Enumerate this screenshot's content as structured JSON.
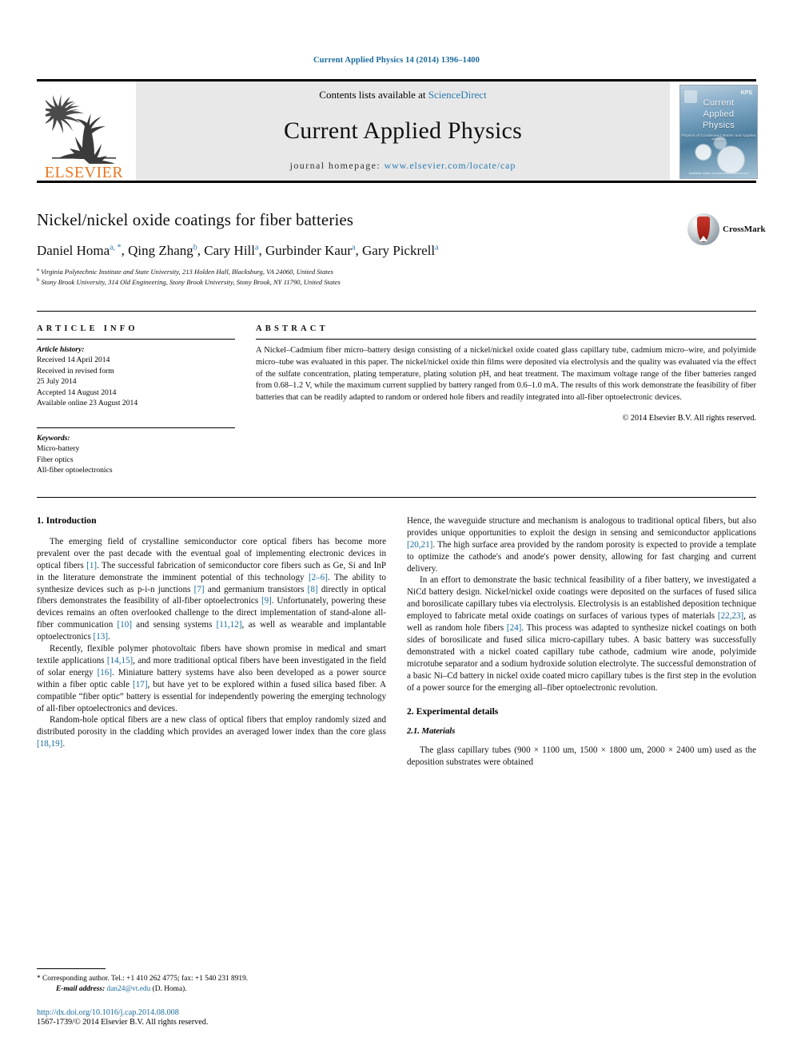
{
  "running_head": "Current Applied Physics 14 (2014) 1396–1400",
  "masthead": {
    "publisher_name": "ELSEVIER",
    "contents_prefix": "Contents lists available at ",
    "contents_link": "ScienceDirect",
    "journal_title": "Current Applied Physics",
    "homepage_prefix": "journal homepage: ",
    "homepage_url": "www.elsevier.com/locate/cap",
    "cover": {
      "line1": "Current",
      "line2": "Applied",
      "line3": "Physics",
      "subtitle": "Physics of Condensed Matter and Applied Physics",
      "badge": "KPS",
      "footer": "Available online at www.sciencedirect.com"
    }
  },
  "article": {
    "title": "Nickel/nickel oxide coatings for fiber batteries",
    "authors": [
      {
        "name": "Daniel Homa",
        "marks": "a, *"
      },
      {
        "name": "Qing Zhang",
        "marks": "b"
      },
      {
        "name": "Cary Hill",
        "marks": "a"
      },
      {
        "name": "Gurbinder Kaur",
        "marks": "a"
      },
      {
        "name": "Gary Pickrell",
        "marks": "a"
      }
    ],
    "affiliations": [
      {
        "mark": "a",
        "text": "Virginia Polytechnic Institute and State University, 213 Holden Hall, Blacksburg, VA 24060, United States"
      },
      {
        "mark": "b",
        "text": "Stony Brook University, 314 Old Engineering, Stony Brook University, Stony Brook, NY 11790, United States"
      }
    ],
    "crossmark_label": "CrossMark"
  },
  "article_info": {
    "heading": "ARTICLE INFO",
    "history_label": "Article history:",
    "history": [
      "Received 14 April 2014",
      "Received in revised form",
      "25 July 2014",
      "Accepted 14 August 2014",
      "Available online 23 August 2014"
    ],
    "keywords_label": "Keywords:",
    "keywords": [
      "Micro-battery",
      "Fiber optics",
      "All-fiber optoelectronics"
    ]
  },
  "abstract": {
    "heading": "ABSTRACT",
    "text": "A Nickel–Cadmium fiber micro–battery design consisting of a nickel/nickel oxide coated glass capillary tube, cadmium micro–wire, and polyimide micro–tube was evaluated in this paper. The nickel/nickel oxide thin films were deposited via electrolysis and the quality was evaluated via the effect of the sulfate concentration, plating temperature, plating solution pH, and heat treatment. The maximum voltage range of the fiber batteries ranged from 0.68–1.2 V, while the maximum current supplied by battery ranged from 0.6–1.0 mA. The results of this work demonstrate the feasibility of fiber batteries that can be readily adapted to random or ordered hole fibers and readily integrated into all-fiber optoelectronic devices.",
    "copyright": "© 2014 Elsevier B.V. All rights reserved."
  },
  "body": {
    "left": {
      "section_heading": "1. Introduction",
      "paragraphs": [
        "The emerging field of crystalline semiconductor core optical fibers has become more prevalent over the past decade with the eventual goal of implementing electronic devices in optical fibers [1]. The successful fabrication of semiconductor core fibers such as Ge, Si and InP in the literature demonstrate the imminent potential of this technology [2–6]. The ability to synthesize devices such as p-i-n junctions [7] and germanium transistors [8] directly in optical fibers demonstrates the feasibility of all-fiber optoelectronics [9]. Unfortunately, powering these devices remains an often overlooked challenge to the direct implementation of stand-alone all-fiber communication [10] and sensing systems [11,12], as well as wearable and implantable optoelectronics [13].",
        "Recently, flexible polymer photovoltaic fibers have shown promise in medical and smart textile applications [14,15], and more traditional optical fibers have been investigated in the field of solar energy [16]. Miniature battery systems have also been developed as a power source within a fiber optic cable [17], but have yet to be explored within a fused silica based fiber. A compatible “fiber optic” battery is essential for independently powering the emerging technology of all-fiber optoelectronics and devices.",
        "Random-hole optical fibers are a new class of optical fibers that employ randomly sized and distributed porosity in the cladding which provides an averaged lower index than the core glass [18,19]."
      ]
    },
    "right": {
      "paragraphs": [
        "Hence, the waveguide structure and mechanism is analogous to traditional optical fibers, but also provides unique opportunities to exploit the design in sensing and semiconductor applications [20,21]. The high surface area provided by the random porosity is expected to provide a template to optimize the cathode's and anode's power density, allowing for fast charging and current delivery.",
        "In an effort to demonstrate the basic technical feasibility of a fiber battery, we investigated a NiCd battery design. Nickel/nickel oxide coatings were deposited on the surfaces of fused silica and borosilicate capillary tubes via electrolysis. Electrolysis is an established deposition technique employed to fabricate metal oxide coatings on surfaces of various types of materials [22,23], as well as random hole fibers [24]. This process was adapted to synthesize nickel coatings on both sides of borosilicate and fused silica micro-capillary tubes. A basic battery was successfully demonstrated with a nickel coated capillary tube cathode, cadmium wire anode, polyimide microtube separator and a sodium hydroxide solution electrolyte. The successful demonstration of a basic Ni–Cd battery in nickel oxide coated micro capillary tubes is the first step in the evolution of a power source for the emerging all–fiber optoelectronic revolution."
      ],
      "section_heading": "2. Experimental details",
      "subsection_heading": "2.1. Materials",
      "subsection_paragraph": "The glass capillary tubes (900 × 1100 um, 1500 × 1800 um, 2000 × 2400 um) used as the deposition substrates were obtained"
    }
  },
  "footnote": {
    "corresponding": "* Corresponding author. Tel.: +1 410 262 4775; fax: +1 540 231 8919.",
    "email_label": "E-mail address:",
    "email": "dan24@vt.edu",
    "email_suffix": "(D. Homa).",
    "doi": "http://dx.doi.org/10.1016/j.cap.2014.08.008",
    "issn": "1567-1739/© 2014 Elsevier B.V. All rights reserved."
  },
  "colors": {
    "link": "#1a6b9c",
    "accent": "#2a7ab0",
    "elsevier_orange": "#E87722"
  }
}
